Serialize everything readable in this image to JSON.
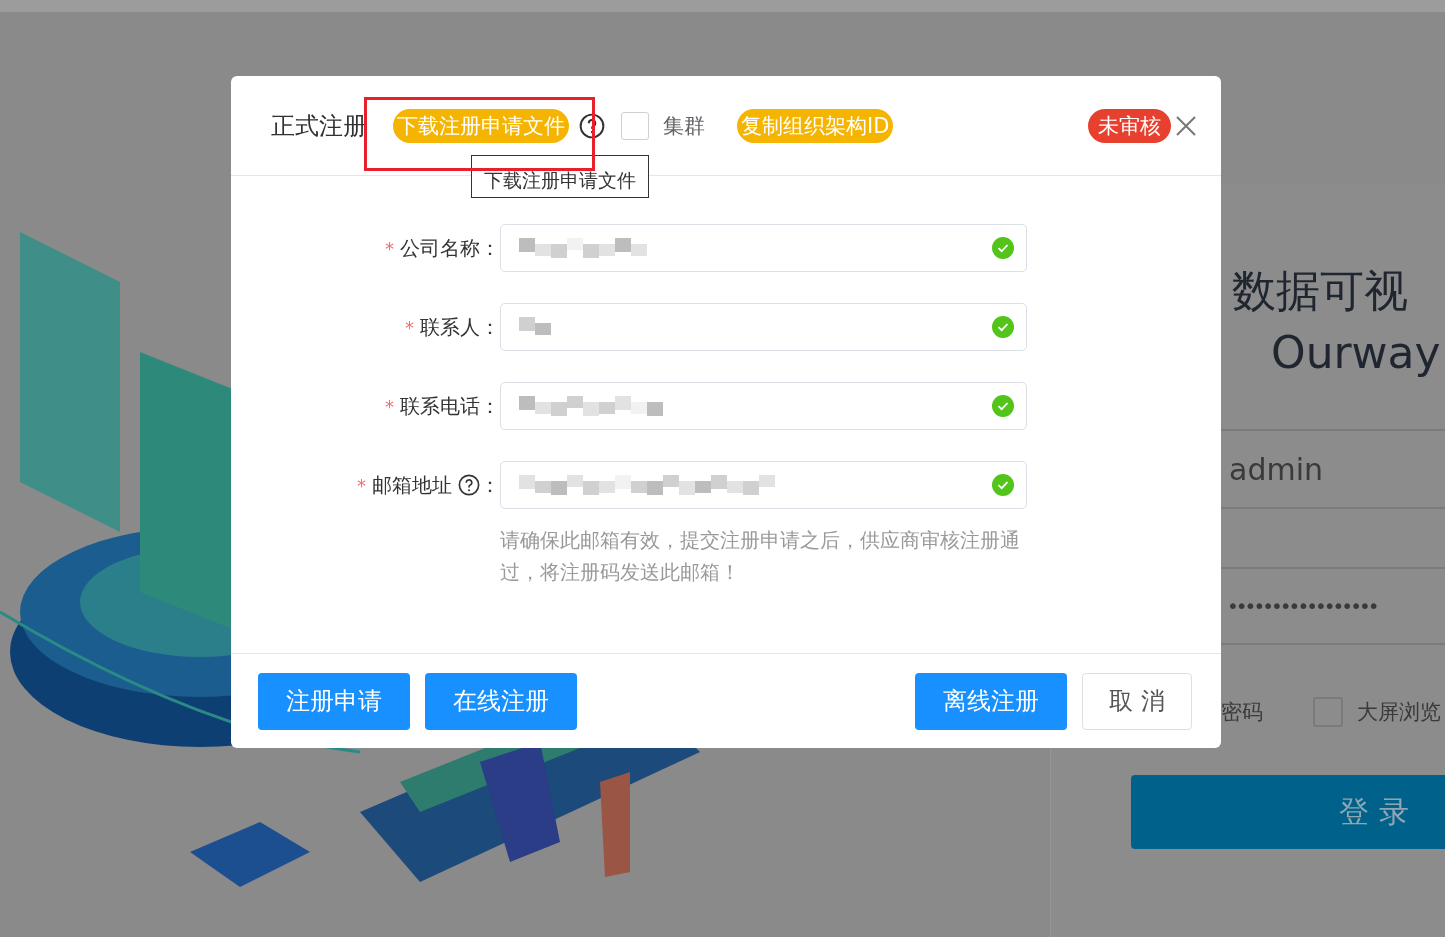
{
  "login": {
    "title": "数据可视",
    "subtitle": "Ourway",
    "username": "admin",
    "password": "•••••••••••••••••",
    "remember_label": "密码",
    "bigscreen": {
      "label": "大屏浏览",
      "checked": false
    },
    "login_button": "登 录"
  },
  "dialog": {
    "title": "正式注册",
    "download_badge": "下载注册申请文件",
    "cluster": {
      "label": "集群",
      "checked": false
    },
    "copy_badge": "复制组织架构ID",
    "status_badge": "未审核",
    "tooltip": "下载注册申请文件",
    "fields": [
      {
        "asterisk": "*",
        "label": "公司名称",
        "colon": "：",
        "help": false,
        "valid": true
      },
      {
        "asterisk": "*",
        "label": "联系人",
        "colon": "：",
        "help": false,
        "valid": true
      },
      {
        "asterisk": "*",
        "label": "联系电话",
        "colon": "：",
        "help": false,
        "valid": true
      },
      {
        "asterisk": "*",
        "label": "邮箱地址",
        "colon": "：",
        "help": true,
        "valid": true
      }
    ],
    "email_hint": "请确保此邮箱有效，提交注册申请之后，供应商审核注册通过，将注册码发送此邮箱！",
    "buttons": [
      {
        "label": "注册申请",
        "kind": "primary"
      },
      {
        "label": "在线注册",
        "kind": "primary"
      },
      {
        "label": "离线注册",
        "kind": "primary"
      },
      {
        "label": "取 消",
        "kind": "default"
      }
    ]
  }
}
